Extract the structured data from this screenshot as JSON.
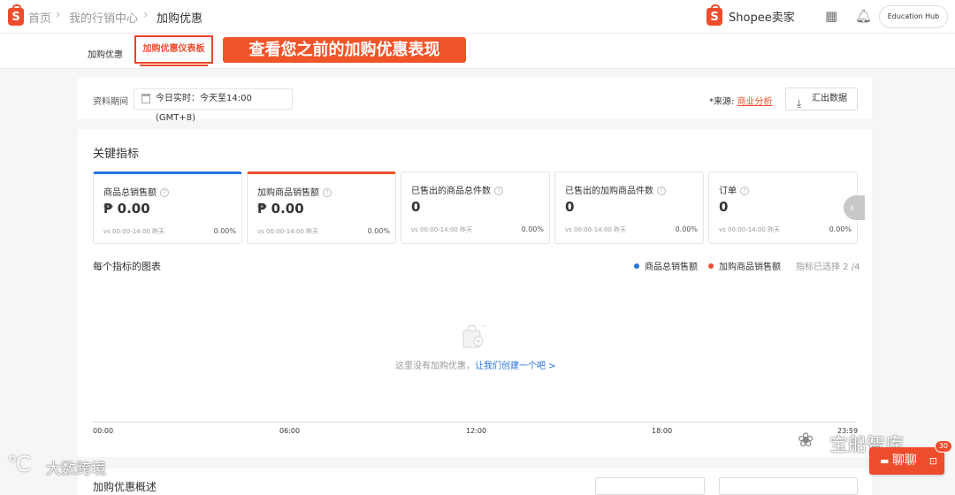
{
  "header": {
    "breadcrumb": [
      "首页",
      "我的行销中心",
      "加购优惠"
    ],
    "brand": "Shopee卖家",
    "hub_button": "Education Hub"
  },
  "tabs": [
    {
      "label": "加购优惠",
      "active": false
    },
    {
      "label": "加购优惠仪表板",
      "active": true
    }
  ],
  "callout": "查看您之前的加购优惠表现",
  "period": {
    "label": "资料期间",
    "value": "今日实时：今天至14:00 (GMT+8)"
  },
  "source": {
    "prefix": "*来源:",
    "link": "商业分析"
  },
  "export_label": "汇出数据",
  "key_metrics": {
    "title": "关键指标",
    "items": [
      {
        "name": "商品总销售额",
        "value": "₱ 0.00",
        "compare": "vs 00:00-14:00 昨天",
        "change": "0.00%",
        "accent": "#2673dd"
      },
      {
        "name": "加购商品销售额",
        "value": "₱ 0.00",
        "compare": "vs 00:00-14:00 昨天",
        "change": "0.00%",
        "accent": "#ee4d2d"
      },
      {
        "name": "已售出的商品总件数",
        "value": "0",
        "compare": "vs 00:00-14:00 昨天",
        "change": "0.00%"
      },
      {
        "name": "已售出的加购商品件数",
        "value": "0",
        "compare": "vs 00:00-14:00 昨天",
        "change": "0.00%"
      },
      {
        "name": "订单",
        "value": "0",
        "compare": "vs 00:00-14:00 昨天",
        "change": "0.00%"
      }
    ]
  },
  "chart": {
    "title": "每个指标的图表",
    "legend": [
      {
        "name": "商品总销售额",
        "color": "#2673dd"
      },
      {
        "name": "加购商品销售额",
        "color": "#ee4d2d"
      }
    ],
    "selected": "指标已选择 2 /4",
    "empty_text": "这里没有加购优惠，",
    "empty_link": "让我们创建一个吧 >",
    "x_ticks": [
      "00:00",
      "06:00",
      "12:00",
      "18:00",
      "23:59"
    ]
  },
  "bottom_title": "加购优惠概述",
  "watermarks": {
    "left": "大数跨境",
    "right": "宝船智库"
  },
  "chat": {
    "label": "聊聊",
    "badge": "30"
  },
  "colors": {
    "brand": "#ee4d2d",
    "accent_blue": "#2673dd"
  }
}
